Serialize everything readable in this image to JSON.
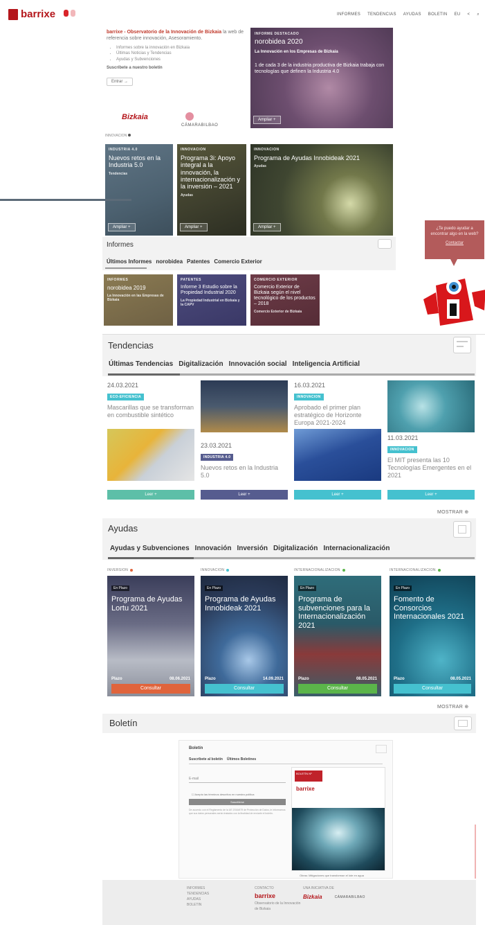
{
  "header": {
    "logo_text": "barrixe",
    "nav": [
      "INFORMES",
      "TENDENCIAS",
      "AYUDAS",
      "BOLETIN",
      "EU"
    ]
  },
  "intro": {
    "lead": "barrixe - Observatorio de la Innovación de Bizkaia",
    "desc": "la web de referencia sobre innovación, Asesoramiento.",
    "bullets": [
      "Informes sobre la innovación en Bizkaia",
      "Últimas Noticias y Tendencias",
      "Ayudas y Subvenciones"
    ],
    "subscribe": "Suscríbete a nuestro boletín",
    "subscribe_btn": "Entrar →",
    "logos": [
      "Bizkaia",
      "CÁMARABILBAO"
    ],
    "more": "INNOVACION"
  },
  "feature": {
    "cat": "INFORME DESTACADO",
    "title": "norobidea 2020",
    "sub": "La Innovación en los Empresas de Bizkaia",
    "bullet": "1 de cada 3 de la industria productiva de Bizkaia trabaja con tecnologías que definen la Industria 4.0",
    "btn": "Ampliar +"
  },
  "cards": [
    {
      "cat": "INDUSTRIA 4.0",
      "title": "Nuevos retos en la Industria 5.0",
      "sub": "Tendencias",
      "btn": "Ampliar +"
    },
    {
      "cat": "INNOVACION",
      "title": "Programa 3i: Apoyo integral a la innovación, la internacionalización y la inversión – 2021",
      "sub": "Ayudas",
      "btn": "Ampliar +"
    },
    {
      "cat": "INNOVACION",
      "title": "Programa de Ayudas Innobideak 2021",
      "sub": "Ayudas",
      "btn": "Ampliar +"
    }
  ],
  "informes": {
    "title": "Informes",
    "tabs": [
      "Últimos Informes",
      "norobidea",
      "Patentes",
      "Comercio Exterior"
    ],
    "cards": [
      {
        "cat": "INFORMES",
        "title": "norobidea 2019",
        "sub": "La Innovación en las Empresas de Bizkaia"
      },
      {
        "cat": "PATENTES",
        "title": "Informe 3 Estudio sobre la Propiedad Industrial 2020",
        "sub": "La Propiedad Industrial en Bizkaia y la CAPV"
      },
      {
        "cat": "COMERCIO EXTERIOR",
        "title": "Comercio Exterior de Bizkaia según el nivel tecnológico de los productos – 2018",
        "sub": "Comercio Exterior de Bizkaia"
      }
    ]
  },
  "mascot": {
    "bubble_text": "¿Te puedo ayudar a encontrar algo en la web?",
    "bubble_link": "Contactar"
  },
  "tendencias": {
    "title": "Tendencias",
    "tabs": [
      "Últimas Tendencias",
      "Digitalización",
      "Innovación social",
      "Inteligencia Artificial"
    ],
    "items": [
      {
        "date": "24.03.2021",
        "badge": "ECO-EFICIENCIA",
        "title": "Mascarillas que se transforman en combustible sintético",
        "btn": "Leer +"
      },
      {
        "date": "23.03.2021",
        "badge": "INDUSTRIA 4.0",
        "title": "Nuevos retos en la Industria 5.0",
        "btn": "Leer +"
      },
      {
        "date": "16.03.2021",
        "badge": "INNOVACION",
        "title": "Aprobado el primer plan estratégico de Horizonte Europa 2021-2024",
        "btn": "Leer +"
      },
      {
        "date": "11.03.2021",
        "badge": "INNOVACION",
        "title": "El MIT presenta las 10 Tecnologías Emergentes en el 2021",
        "btn": "Leer +"
      }
    ],
    "mostrar": "MOSTRAR"
  },
  "ayudas": {
    "title": "Ayudas",
    "tabs": [
      "Ayudas y Subvenciones",
      "Innovación",
      "Inversión",
      "Digitalización",
      "Internacionalización"
    ],
    "items": [
      {
        "cat": "INVERSION",
        "flag": "En Plazo",
        "title": "Programa de Ayudas Lortu 2021",
        "plazo_label": "Plazo",
        "plazo": "08.06.2021",
        "btn": "Consultar"
      },
      {
        "cat": "INNOVACION",
        "flag": "En Plazo",
        "title": "Programa de Ayudas Innobideak 2021",
        "plazo_label": "Plazo",
        "plazo": "14.09.2021",
        "btn": "Consultar"
      },
      {
        "cat": "INTERNACIONALIZACION",
        "flag": "En Plazo",
        "title": "Programa de subvenciones para la Internacionalización 2021",
        "plazo_label": "Plazo",
        "plazo": "08.05.2021",
        "btn": "Consultar"
      },
      {
        "cat": "INTERNACIONALIZACION",
        "flag": "En Plazo",
        "title": "Fomento de Consorcios Internacionales 2021",
        "plazo_label": "Plazo",
        "plazo": "08.05.2021",
        "btn": "Consultar"
      }
    ],
    "mostrar": "MOSTRAR"
  },
  "boletin": {
    "title": "Boletín",
    "inner_title": "Boletín",
    "tabs": [
      "Suscríbete al boletín",
      "Últimos Boletines"
    ],
    "email_label": "E-mail",
    "accept": "Acepto las términos descritos en nuestra política",
    "btn": "Suscribirse",
    "legal": "De acuerdo con el Reglamento de la UE 2016/679 de Protección de Datos, le informamos que sus datos personales serán tratados con la finalidad de enviarle el boletín.",
    "caption": "Obras: Mitigaciones que transforman el lote en agua",
    "preview_logo": "barrixe",
    "preview_tag": "BOLETÍN Nº"
  },
  "footer": {
    "col1": [
      "INFORMES",
      "TENDENCIAS",
      "AYUDAS",
      "BOLETIN"
    ],
    "col2_title": "CONTACTO",
    "col2_logo": "barrixe",
    "col2_text": "Observatorio de la Innovación de Bizkaia",
    "col3_title": "UNA INICIATIVA DE",
    "col3_logos": [
      "Bizkaia",
      "CÁMARABILBAO"
    ]
  },
  "colors": {
    "brand": "#b4161b",
    "teal": "#45c1cf",
    "indigo": "#565c8f",
    "orange": "#e0643c",
    "green": "#5bb54a"
  }
}
